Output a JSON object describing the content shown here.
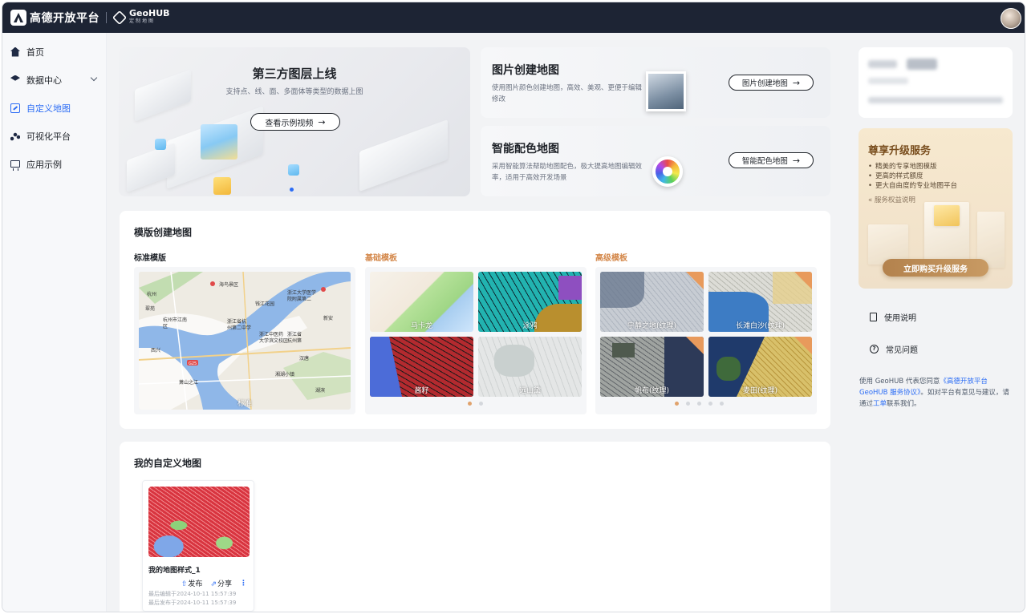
{
  "brand": {
    "name": "高德开放平台",
    "sub_name": "GeoHUB",
    "sub_tagline": "定制地图"
  },
  "sidebar": {
    "items": [
      {
        "label": "首页",
        "icon": "home-icon"
      },
      {
        "label": "数据中心",
        "icon": "layers-icon"
      },
      {
        "label": "自定义地图",
        "icon": "custom-map-icon",
        "active": true
      },
      {
        "label": "可视化平台",
        "icon": "viz-icon"
      },
      {
        "label": "应用示例",
        "icon": "app-icon"
      }
    ]
  },
  "banner": {
    "title": "第三方图层上线",
    "subtitle": "支持点、线、面、多面体等类型的数据上图",
    "button": "查看示例视频"
  },
  "features": [
    {
      "title": "图片创建地图",
      "desc": "使用图片颜色创建地图，高效、美观、更便于编辑修改",
      "button": "图片创建地图"
    },
    {
      "title": "智能配色地图",
      "desc": "采用智能算法帮助地图配色，极大提高地图编辑效率，适用于高效开发场景",
      "button": "智能配色地图"
    }
  ],
  "templates": {
    "title": "模版创建地图",
    "standard": {
      "label": "标准模版",
      "tile": "标准"
    },
    "basic": {
      "label": "基础模板",
      "tiles": [
        "马卡龙",
        "涂鸦",
        "酱籽",
        "远山黛"
      ]
    },
    "advanced": {
      "label": "高级模板",
      "tiles": [
        "宁静之地(纹理)",
        "长滩白沙(纹理)",
        "帆布(纹理)",
        "麦田(纹理)"
      ]
    }
  },
  "standard_map_labels": {
    "a": "海鸟景区",
    "b": "浙江大学医学",
    "c": "院附属第二",
    "d": "杭州",
    "e": "钱江花园",
    "f": "杭州市江南",
    "g": "区",
    "h": "浙江中医药",
    "i": "大学滨文校区",
    "j": "浙江省杭",
    "k": "州第二中学",
    "l": "浙江省",
    "m": "杭州第",
    "n": "湘湖小镇",
    "o": "西兴",
    "p": "汉唐",
    "q": "G25",
    "r": "萧山之江",
    "s": "新安",
    "t": "翠苑",
    "u": "湖滨"
  },
  "my_maps": {
    "title": "我的自定义地图",
    "items": [
      {
        "name": "我的地图样式_1",
        "publish": "发布",
        "share": "分享",
        "edited": "最后编辑于2024-10-11 15:57:39",
        "published": "最后发布于2024-10-11 15:57:39"
      }
    ]
  },
  "upgrade": {
    "title": "尊享升级服务",
    "items": [
      "精美的专享地图模版",
      "更高的样式额度",
      "更大自由度的专业地图平台"
    ],
    "link": "服务权益说明",
    "button": "立即购买升级服务"
  },
  "help": {
    "usage": "使用说明",
    "faq": "常见问题"
  },
  "legal": {
    "prefix": "使用 GeoHUB 代表您同意",
    "link1": "《高德开放平台GeoHUB 服务协议》",
    "middle": "。如对平台有意见与建议，请通过",
    "link2": "工单",
    "suffix": "联系我们。"
  },
  "colors": {
    "accent": "#2b6cf5",
    "topbar": "#1d2434",
    "upgrade_brown": "#b3824d",
    "template_orange": "#e0a26c"
  }
}
